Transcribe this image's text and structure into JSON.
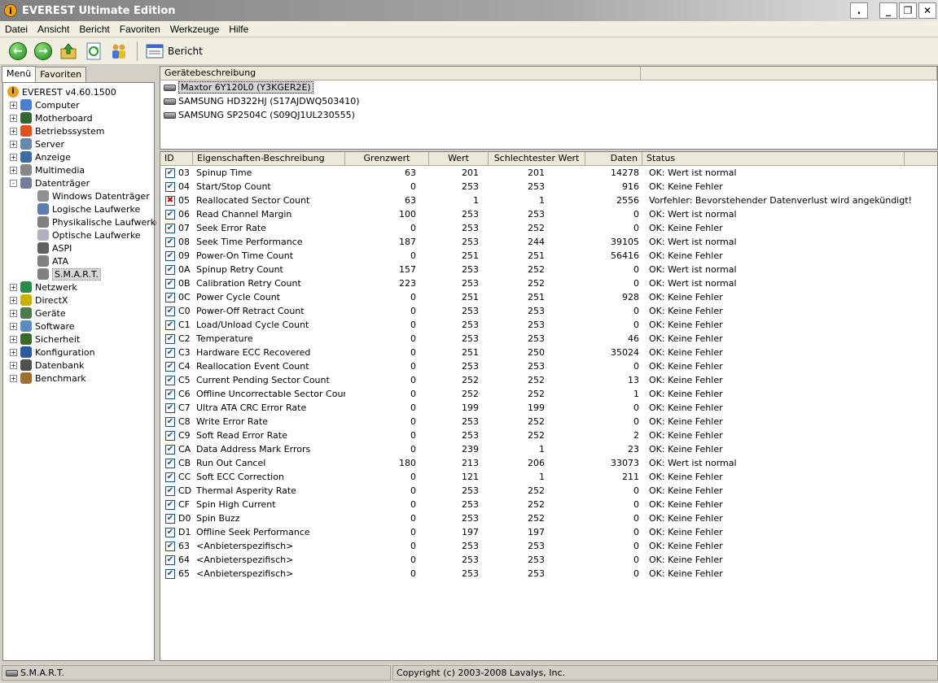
{
  "window": {
    "title": "EVEREST Ultimate Edition"
  },
  "menu": [
    "Datei",
    "Ansicht",
    "Bericht",
    "Favoriten",
    "Werkzeuge",
    "Hilfe"
  ],
  "toolbar": {
    "report_label": "Bericht"
  },
  "left_tabs": [
    "Menü",
    "Favoriten"
  ],
  "tree": {
    "root": "EVEREST v4.60.1500",
    "items": [
      {
        "label": "Computer",
        "expander": "+",
        "depth": 1,
        "icon": "computer-icon",
        "color": "#4a7fcf"
      },
      {
        "label": "Motherboard",
        "expander": "+",
        "depth": 1,
        "icon": "motherboard-icon",
        "color": "#336633"
      },
      {
        "label": "Betriebssystem",
        "expander": "+",
        "depth": 1,
        "icon": "windows-logo-icon",
        "color": "#e05020"
      },
      {
        "label": "Server",
        "expander": "+",
        "depth": 1,
        "icon": "server-icon",
        "color": "#6688aa"
      },
      {
        "label": "Anzeige",
        "expander": "+",
        "depth": 1,
        "icon": "monitor-icon",
        "color": "#3a6ea5"
      },
      {
        "label": "Multimedia",
        "expander": "+",
        "depth": 1,
        "icon": "multimedia-icon",
        "color": "#888888"
      },
      {
        "label": "Datenträger",
        "expander": "-",
        "depth": 1,
        "icon": "storage-icon",
        "color": "#7a7a9a"
      },
      {
        "label": "Windows Datenträger",
        "expander": "",
        "depth": 2,
        "icon": "drive-icon",
        "color": "#909090"
      },
      {
        "label": "Logische Laufwerke",
        "expander": "",
        "depth": 2,
        "icon": "logical-drive-icon",
        "color": "#5a7fb0"
      },
      {
        "label": "Physikalische Laufwerke",
        "expander": "",
        "depth": 2,
        "icon": "hard-disk-icon",
        "color": "#808080"
      },
      {
        "label": "Optische Laufwerke",
        "expander": "",
        "depth": 2,
        "icon": "optical-drive-icon",
        "color": "#b0b0c0"
      },
      {
        "label": "ASPI",
        "expander": "",
        "depth": 2,
        "icon": "aspi-icon",
        "color": "#606060"
      },
      {
        "label": "ATA",
        "expander": "",
        "depth": 2,
        "icon": "ata-icon",
        "color": "#808080"
      },
      {
        "label": "S.M.A.R.T.",
        "expander": "",
        "depth": 2,
        "icon": "smart-icon",
        "color": "#808080",
        "selected": true
      },
      {
        "label": "Netzwerk",
        "expander": "+",
        "depth": 1,
        "icon": "network-icon",
        "color": "#2a8a4a"
      },
      {
        "label": "DirectX",
        "expander": "+",
        "depth": 1,
        "icon": "directx-icon",
        "color": "#c8b000"
      },
      {
        "label": "Geräte",
        "expander": "+",
        "depth": 1,
        "icon": "devices-icon",
        "color": "#4a7a4a"
      },
      {
        "label": "Software",
        "expander": "+",
        "depth": 1,
        "icon": "software-icon",
        "color": "#5a8ac0"
      },
      {
        "label": "Sicherheit",
        "expander": "+",
        "depth": 1,
        "icon": "security-shield-icon",
        "color": "#3a6a2a"
      },
      {
        "label": "Konfiguration",
        "expander": "+",
        "depth": 1,
        "icon": "configuration-icon",
        "color": "#2a5aa0"
      },
      {
        "label": "Datenbank",
        "expander": "+",
        "depth": 1,
        "icon": "database-icon",
        "color": "#505050"
      },
      {
        "label": "Benchmark",
        "expander": "+",
        "depth": 1,
        "icon": "hourglass-icon",
        "color": "#a07030"
      }
    ]
  },
  "devices": {
    "header": "Gerätebeschreibung",
    "list": [
      {
        "name": "Maxtor 6Y120L0 (Y3KGER2E)",
        "selected": true
      },
      {
        "name": "SAMSUNG HD322HJ (S17AJDWQ503410)"
      },
      {
        "name": "SAMSUNG SP2504C (S09QJ1UL230555)"
      }
    ]
  },
  "smart": {
    "columns": [
      "ID",
      "Eigenschaften-Beschreibung",
      "Grenzwert",
      "Wert",
      "Schlechtester Wert",
      "Daten",
      "Status"
    ],
    "rows": [
      {
        "id": "03",
        "name": "Spinup Time",
        "g": "63",
        "w": "201",
        "s": "201",
        "d": "14278",
        "st": "OK: Wert ist normal",
        "ok": true
      },
      {
        "id": "04",
        "name": "Start/Stop Count",
        "g": "0",
        "w": "253",
        "s": "253",
        "d": "916",
        "st": "OK: Keine Fehler",
        "ok": true
      },
      {
        "id": "05",
        "name": "Reallocated Sector Count",
        "g": "63",
        "w": "1",
        "s": "1",
        "d": "2556",
        "st": "Vorfehler: Bevorstehender Datenverlust wird angekündigt!",
        "ok": false
      },
      {
        "id": "06",
        "name": "Read Channel Margin",
        "g": "100",
        "w": "253",
        "s": "253",
        "d": "0",
        "st": "OK: Wert ist normal",
        "ok": true
      },
      {
        "id": "07",
        "name": "Seek Error Rate",
        "g": "0",
        "w": "253",
        "s": "252",
        "d": "0",
        "st": "OK: Keine Fehler",
        "ok": true
      },
      {
        "id": "08",
        "name": "Seek Time Performance",
        "g": "187",
        "w": "253",
        "s": "244",
        "d": "39105",
        "st": "OK: Wert ist normal",
        "ok": true
      },
      {
        "id": "09",
        "name": "Power-On Time Count",
        "g": "0",
        "w": "251",
        "s": "251",
        "d": "56416",
        "st": "OK: Keine Fehler",
        "ok": true
      },
      {
        "id": "0A",
        "name": "Spinup Retry Count",
        "g": "157",
        "w": "253",
        "s": "252",
        "d": "0",
        "st": "OK: Wert ist normal",
        "ok": true
      },
      {
        "id": "0B",
        "name": "Calibration Retry Count",
        "g": "223",
        "w": "253",
        "s": "252",
        "d": "0",
        "st": "OK: Wert ist normal",
        "ok": true
      },
      {
        "id": "0C",
        "name": "Power Cycle Count",
        "g": "0",
        "w": "251",
        "s": "251",
        "d": "928",
        "st": "OK: Keine Fehler",
        "ok": true
      },
      {
        "id": "C0",
        "name": "Power-Off Retract Count",
        "g": "0",
        "w": "253",
        "s": "253",
        "d": "0",
        "st": "OK: Keine Fehler",
        "ok": true
      },
      {
        "id": "C1",
        "name": "Load/Unload Cycle Count",
        "g": "0",
        "w": "253",
        "s": "253",
        "d": "0",
        "st": "OK: Keine Fehler",
        "ok": true
      },
      {
        "id": "C2",
        "name": "Temperature",
        "g": "0",
        "w": "253",
        "s": "253",
        "d": "46",
        "st": "OK: Keine Fehler",
        "ok": true
      },
      {
        "id": "C3",
        "name": "Hardware ECC Recovered",
        "g": "0",
        "w": "251",
        "s": "250",
        "d": "35024",
        "st": "OK: Keine Fehler",
        "ok": true
      },
      {
        "id": "C4",
        "name": "Reallocation Event Count",
        "g": "0",
        "w": "253",
        "s": "253",
        "d": "0",
        "st": "OK: Keine Fehler",
        "ok": true
      },
      {
        "id": "C5",
        "name": "Current Pending Sector Count",
        "g": "0",
        "w": "252",
        "s": "252",
        "d": "13",
        "st": "OK: Keine Fehler",
        "ok": true
      },
      {
        "id": "C6",
        "name": "Offline Uncorrectable Sector Count",
        "g": "0",
        "w": "252",
        "s": "252",
        "d": "1",
        "st": "OK: Keine Fehler",
        "ok": true
      },
      {
        "id": "C7",
        "name": "Ultra ATA CRC Error Rate",
        "g": "0",
        "w": "199",
        "s": "199",
        "d": "0",
        "st": "OK: Keine Fehler",
        "ok": true
      },
      {
        "id": "C8",
        "name": "Write Error Rate",
        "g": "0",
        "w": "253",
        "s": "252",
        "d": "0",
        "st": "OK: Keine Fehler",
        "ok": true
      },
      {
        "id": "C9",
        "name": "Soft Read Error Rate",
        "g": "0",
        "w": "253",
        "s": "252",
        "d": "2",
        "st": "OK: Keine Fehler",
        "ok": true
      },
      {
        "id": "CA",
        "name": "Data Address Mark Errors",
        "g": "0",
        "w": "239",
        "s": "1",
        "d": "23",
        "st": "OK: Keine Fehler",
        "ok": true
      },
      {
        "id": "CB",
        "name": "Run Out Cancel",
        "g": "180",
        "w": "213",
        "s": "206",
        "d": "33073",
        "st": "OK: Wert ist normal",
        "ok": true
      },
      {
        "id": "CC",
        "name": "Soft ECC Correction",
        "g": "0",
        "w": "121",
        "s": "1",
        "d": "211",
        "st": "OK: Keine Fehler",
        "ok": true
      },
      {
        "id": "CD",
        "name": "Thermal Asperity Rate",
        "g": "0",
        "w": "253",
        "s": "252",
        "d": "0",
        "st": "OK: Keine Fehler",
        "ok": true
      },
      {
        "id": "CF",
        "name": "Spin High Current",
        "g": "0",
        "w": "253",
        "s": "252",
        "d": "0",
        "st": "OK: Keine Fehler",
        "ok": true
      },
      {
        "id": "D0",
        "name": "Spin Buzz",
        "g": "0",
        "w": "253",
        "s": "252",
        "d": "0",
        "st": "OK: Keine Fehler",
        "ok": true
      },
      {
        "id": "D1",
        "name": "Offline Seek Performance",
        "g": "0",
        "w": "197",
        "s": "197",
        "d": "0",
        "st": "OK: Keine Fehler",
        "ok": true
      },
      {
        "id": "63",
        "name": "<Anbieterspezifisch>",
        "g": "0",
        "w": "253",
        "s": "253",
        "d": "0",
        "st": "OK: Keine Fehler",
        "ok": true
      },
      {
        "id": "64",
        "name": "<Anbieterspezifisch>",
        "g": "0",
        "w": "253",
        "s": "253",
        "d": "0",
        "st": "OK: Keine Fehler",
        "ok": true
      },
      {
        "id": "65",
        "name": "<Anbieterspezifisch>",
        "g": "0",
        "w": "253",
        "s": "253",
        "d": "0",
        "st": "OK: Keine Fehler",
        "ok": true
      }
    ]
  },
  "status_bar": {
    "left": "S.M.A.R.T.",
    "right": "Copyright (c) 2003-2008 Lavalys, Inc."
  }
}
